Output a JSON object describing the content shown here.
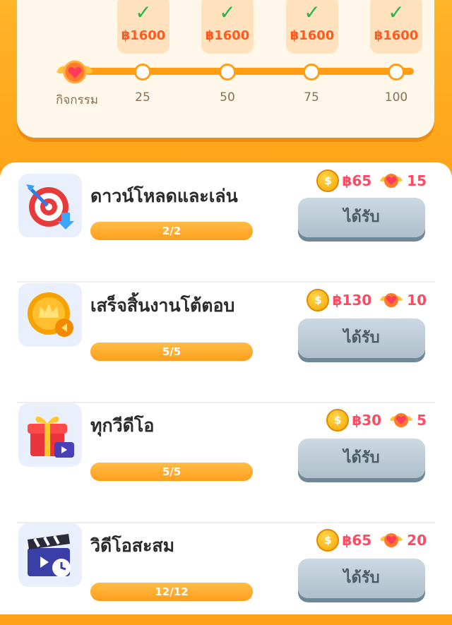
{
  "progress": {
    "milestones": [
      {
        "amount": "฿1600",
        "completed": true
      },
      {
        "amount": "฿1600",
        "completed": true
      },
      {
        "amount": "฿1600",
        "completed": true
      },
      {
        "amount": "฿1600",
        "completed": true
      }
    ],
    "activity_label": "กิจกรรม",
    "ticks": [
      "25",
      "50",
      "75",
      "100"
    ],
    "check_glyph": "✓"
  },
  "tasks": [
    {
      "title": "ดาวน์โหลดและเล่น",
      "progress_text": "2/2",
      "progress_fraction": 1.0,
      "cash_reward": "฿65",
      "heart_reward": "15",
      "button_label": "ได้รับ",
      "icon": "dart-target-download-icon"
    },
    {
      "title": "เสร็จสิ้นงานโต้ตอบ",
      "progress_text": "5/5",
      "progress_fraction": 1.0,
      "cash_reward": "฿130",
      "heart_reward": "10",
      "button_label": "ได้รับ",
      "icon": "crown-coin-icon"
    },
    {
      "title": "ทุกวีดีโอ",
      "progress_text": "5/5",
      "progress_fraction": 1.0,
      "cash_reward": "฿30",
      "heart_reward": "5",
      "button_label": "ได้รับ",
      "icon": "gift-video-icon"
    },
    {
      "title": "วิดีโอสะสม",
      "progress_text": "12/12",
      "progress_fraction": 1.0,
      "cash_reward": "฿65",
      "heart_reward": "20",
      "button_label": "ได้รับ",
      "icon": "clapperboard-clock-icon"
    }
  ],
  "colors": {
    "accent": "#ffa21a",
    "reward_text": "#ff4a62",
    "check": "#22b84b"
  }
}
